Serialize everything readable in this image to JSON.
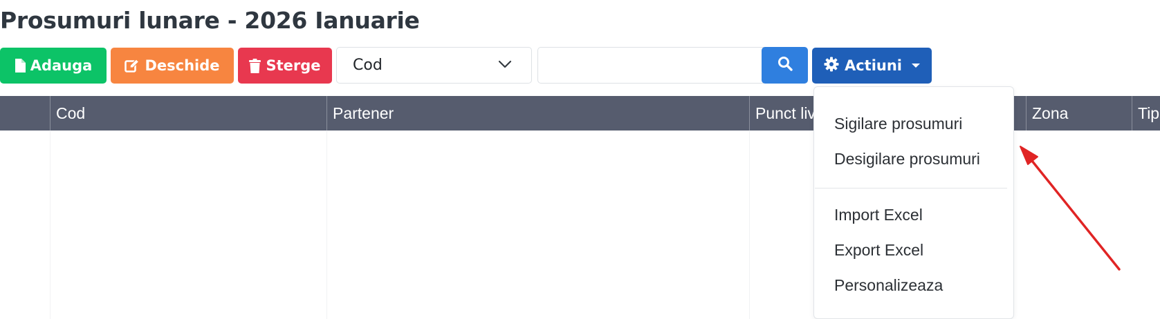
{
  "page": {
    "title": "Prosumuri lunare - 2026 Ianuarie"
  },
  "toolbar": {
    "add_label": "Adauga",
    "open_label": "Deschide",
    "delete_label": "Sterge",
    "field_select": {
      "selected": "Cod"
    },
    "search": {
      "value": "",
      "placeholder": ""
    },
    "actions_label": "Actiuni"
  },
  "table": {
    "columns": [
      {
        "label": ""
      },
      {
        "label": "Cod"
      },
      {
        "label": "Partener"
      },
      {
        "label": "Punct livrare"
      },
      {
        "label": "Zona"
      },
      {
        "label": "Tip"
      }
    ]
  },
  "actions_menu": {
    "items": [
      {
        "label": "Sigilare prosumuri"
      },
      {
        "label": "Desigilare prosumuri"
      },
      {
        "label": "Import Excel"
      },
      {
        "label": "Export Excel"
      },
      {
        "label": "Personalizeaza"
      }
    ]
  },
  "colors": {
    "add": "#0cc367",
    "open": "#f78540",
    "delete": "#e8384f",
    "search": "#2f7fdf",
    "actions": "#1f5fb8",
    "table_header": "#565c6e",
    "annotation_arrow": "#e02424"
  },
  "icons": {
    "add": "file-icon",
    "open": "edit-icon",
    "delete": "trash-icon",
    "select": "chevron-down-icon",
    "search": "search-icon",
    "actions": "gear-icon",
    "actions_caret": "caret-down-icon"
  }
}
